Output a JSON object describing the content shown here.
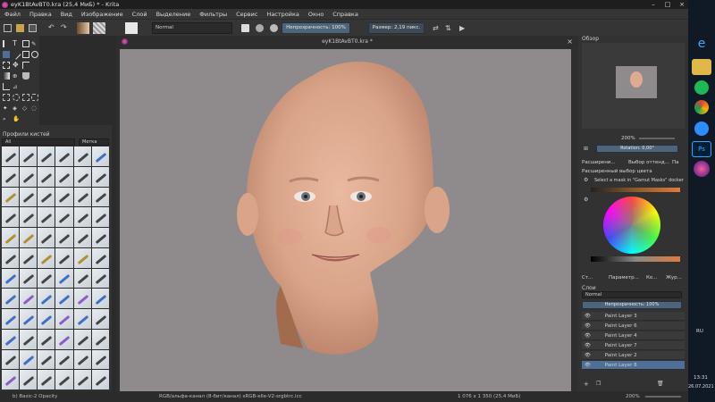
{
  "window": {
    "title": "eyK1BtAvBT0.kra (25,4 МиБ)  *  - Krita"
  },
  "menu": [
    "Файл",
    "Правка",
    "Вид",
    "Изображение",
    "Слой",
    "Выделение",
    "Фильтры",
    "Сервис",
    "Настройка",
    "Окно",
    "Справка"
  ],
  "tool_options": {
    "blend_mode": "Normal",
    "opacity_label": "Непрозрачность: 100%",
    "size_label": "Размер: 2,19 пикс."
  },
  "brush_presets": {
    "title": "Профили кистей",
    "filter_all": "All",
    "tag_label": "Метка"
  },
  "document": {
    "tab_title": "eyK1BtAvBT0.kra *"
  },
  "overview": {
    "title": "Обзор",
    "zoom": "200%",
    "rotation_label": "Rotation: 0,00°"
  },
  "advanced_color": {
    "tab_extended": "Расширени...",
    "tab_color_picker": "Выбор оттенд...",
    "tab_pa": "Па",
    "panel_title": "Расширенный выбор цвета",
    "hint": "Select a mask in \"Gamut Masks\" docker"
  },
  "dock_tabs": {
    "st": "Ст...",
    "params": "Параметр...",
    "ko": "Ко...",
    "jour": "Жур..."
  },
  "layers": {
    "title": "Слои",
    "blend_mode": "Normal",
    "opacity_label": "Непрозрачность: 100%",
    "items": [
      {
        "name": "Paint Layer 3",
        "selected": false
      },
      {
        "name": "Paint Layer 6",
        "selected": false
      },
      {
        "name": "Paint Layer 4",
        "selected": false
      },
      {
        "name": "Paint Layer 7",
        "selected": false
      },
      {
        "name": "Paint Layer 2",
        "selected": false
      },
      {
        "name": "Paint Layer 8",
        "selected": true
      }
    ]
  },
  "status": {
    "brush": "b) Basic-2 Opacity",
    "color_space": "RGB/альфа-канал (8-бит/канал)  sRGB-elle-V2-srgbtrc.icc",
    "dimensions": "1 076 x 1 350 (25,4 МиБ)",
    "zoom": "200%"
  },
  "taskbar": {
    "lang": "RU",
    "time": "13:31",
    "date": "26.07.2021"
  },
  "colors": {
    "accent": "#4f6f96",
    "canvas_bg": "#8f8a8c",
    "panel_bg": "#323232"
  }
}
